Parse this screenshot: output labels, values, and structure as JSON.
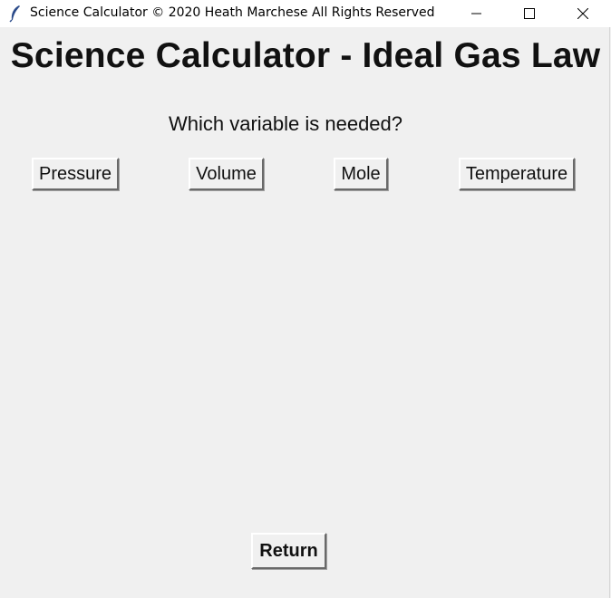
{
  "window": {
    "title": "Science Calculator © 2020 Heath Marchese All Rights Reserved",
    "app_icon": "feather-icon",
    "controls": [
      "minimize-icon",
      "maximize-icon",
      "close-icon"
    ]
  },
  "main": {
    "heading": "Science Calculator - Ideal Gas Law",
    "prompt": "Which variable is needed?",
    "buttons": {
      "pressure": "Pressure",
      "volume": "Volume",
      "mole": "Mole",
      "temperature": "Temperature"
    },
    "return_label": "Return"
  },
  "colors": {
    "background": "#f0f0f0",
    "titlebar": "#ffffff",
    "text": "#111111"
  }
}
